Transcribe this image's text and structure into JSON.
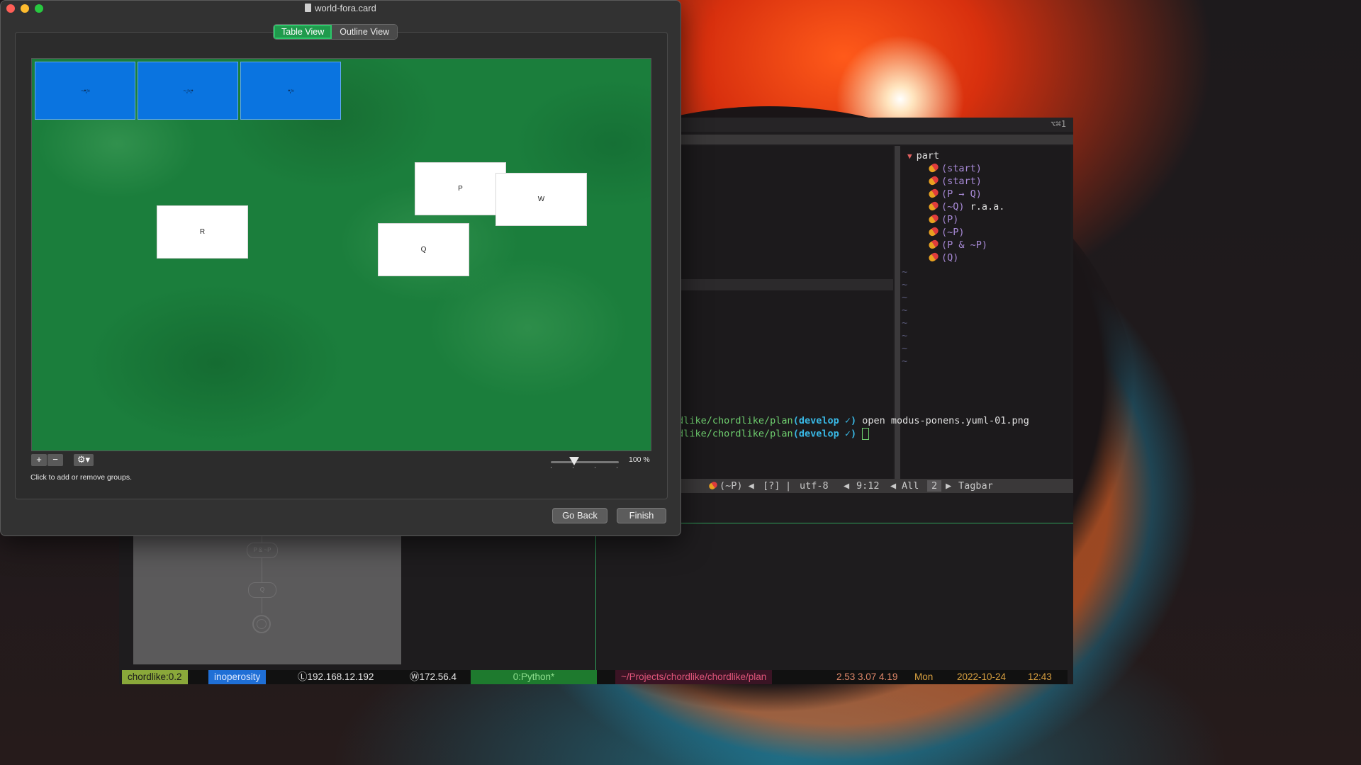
{
  "window": {
    "title": "world-fora.card",
    "tabs": [
      {
        "label": "Table View",
        "active": true
      },
      {
        "label": "Outline View",
        "active": false
      }
    ],
    "blue_cards": [
      "~•,≈",
      "~,≈,•",
      "•,≈"
    ],
    "white_cards": [
      "R",
      "P",
      "W",
      "Q"
    ],
    "toolbar": {
      "add_label": "+",
      "remove_label": "−",
      "gear_label": "⚙▾"
    },
    "hint": "Click to add or remove groups.",
    "zoom": {
      "label": "100 %",
      "value": 1.0
    },
    "buttons": {
      "back": "Go Back",
      "finish": "Finish"
    },
    "colors": {
      "table_green": "#1b7e3c",
      "card_blue": "#0a74e0",
      "active_tab": "#1f9a4c"
    }
  },
  "terminal": {
    "shortcut": "⌥⌘1",
    "tagbar": {
      "root": "part",
      "items": [
        {
          "text": "(start)",
          "note": ""
        },
        {
          "text": "(start)",
          "note": ""
        },
        {
          "text": "(P → Q)",
          "note": ""
        },
        {
          "text": "(~Q)",
          "note": "r.a.a."
        },
        {
          "text": "(P)",
          "note": ""
        },
        {
          "text": "(~P)",
          "note": ""
        },
        {
          "text": "(P & ~P)",
          "note": ""
        },
        {
          "text": "(Q)",
          "note": ""
        }
      ]
    },
    "vim_status": {
      "tag": "(~P)",
      "help": "[?]",
      "encoding": "utf-8",
      "position": "9:12",
      "scroll": "All",
      "window_number": "2",
      "window_name": "Tagbar"
    },
    "shell": {
      "lines": [
        {
          "path": "rdlike/chordlike/plan",
          "branch": "(develop ✓)",
          "command": " open modus-ponens.yuml-01.png"
        },
        {
          "path": "rdlike/chordlike/plan",
          "branch": "(develop ✓)",
          "command": " "
        }
      ]
    },
    "preview": {
      "nodes": [
        "P & ~P",
        "Q"
      ]
    },
    "tmux": {
      "session": "chordlike:0.2",
      "host": "inoperosity",
      "local_ip": "Ⓛ192.168.12.192",
      "wan_ip": "Ⓦ172.56.4",
      "window": "0:Python*",
      "cwd": "~/Projects/chordlike/chordlike/plan",
      "load": "2.53 3.07 4.19",
      "day": "Mon",
      "date": "2022-10-24",
      "time": "12:43"
    }
  }
}
